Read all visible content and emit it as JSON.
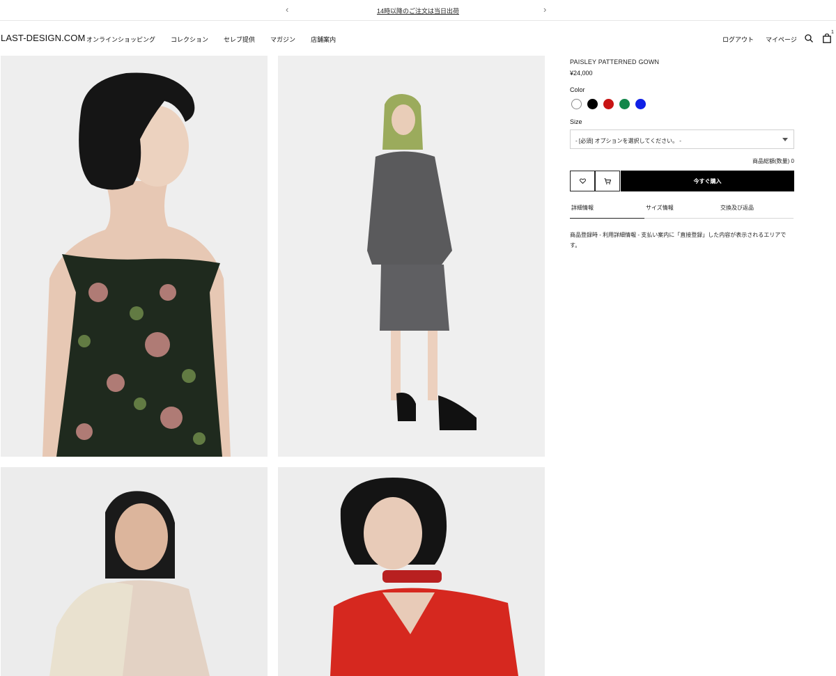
{
  "announcement": {
    "prev_icon": "chevron-left-icon",
    "next_icon": "chevron-right-icon",
    "message": "14時以降のご注文は当日出荷"
  },
  "header": {
    "logo": "LAST-DESIGN.COM",
    "nav": [
      "オンラインショッピング",
      "コレクション",
      "セレブ提供",
      "マガジン",
      "店舗案内"
    ],
    "logout": "ログアウト",
    "mypage": "マイページ",
    "search_icon": "search-icon",
    "bag_icon": "shopping-bag-icon",
    "bag_count": "1"
  },
  "gallery": {
    "images": [
      {
        "subject": "model in floral tapestry strapless gown, side profile"
      },
      {
        "subject": "model in grey blazer and skirt, full body"
      },
      {
        "subject": "model with knit crochet bag"
      },
      {
        "subject": "model in red blazer with spiked collar"
      }
    ]
  },
  "product": {
    "name": "PAISLEY PATTERNED GOWN",
    "price": "¥24,000",
    "color_label": "Color",
    "colors": [
      "#ffffff",
      "#000000",
      "#c81414",
      "#12874a",
      "#1020e6"
    ],
    "size_label": "Size",
    "size_select_value": "- [必須] オプションを選択してください。 -",
    "total": "商品総額(数量) 0",
    "wishlist_icon": "heart-icon",
    "cart_icon": "cart-icon",
    "buy_label": "今すぐ購入",
    "tabs": [
      "詳細情報",
      "サイズ情報",
      "交換及び返品"
    ],
    "description": "商品登録時 - 利用詳細情報 - 支払い案内に「直接登録」した内容が表示されるエリアです。"
  }
}
